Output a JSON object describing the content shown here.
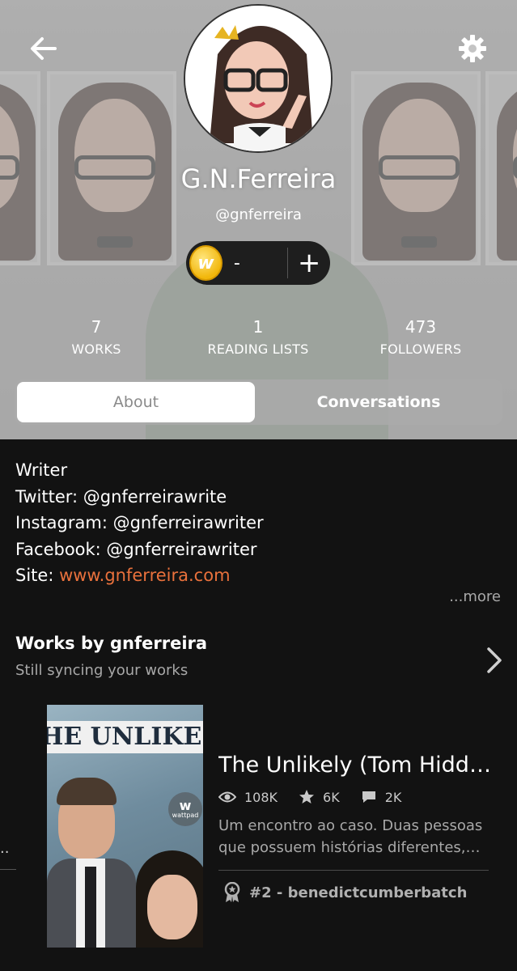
{
  "header": {
    "username": "G.N.Ferreira",
    "handle": "@gnferreira",
    "coins": {
      "count": "-",
      "plus": "+",
      "coin_glyph": "w"
    },
    "stats": [
      {
        "value": "7",
        "label": "WORKS"
      },
      {
        "value": "1",
        "label": "READING LISTS"
      },
      {
        "value": "473",
        "label": "FOLLOWERS"
      }
    ],
    "tabs": {
      "about": "About",
      "conversations": "Conversations"
    },
    "icons": {
      "back": "back-arrow-icon",
      "settings": "gear-icon"
    }
  },
  "bio": {
    "line1": "Writer",
    "line2": "Twitter: @gnferreirawrite",
    "line3": "Instagram: @gnferreirawriter",
    "line4": "Facebook: @gnferreirawriter",
    "site_prefix": "Site: ",
    "site_link": "www.gnferreira.com",
    "more": "...more"
  },
  "works": {
    "title": "Works by gnferreira",
    "subtitle": "Still syncing your works",
    "left_peek": "..",
    "story": {
      "cover_text": "HE UNLIKE",
      "cover_badge": "w",
      "cover_badge_label": "wattpad",
      "title": "The Unlikely (Tom Hidd…",
      "reads": "108K",
      "votes": "6K",
      "comments": "2K",
      "description_line1": "Um encontro ao caso. Duas pessoas",
      "description_line2": "que possuem histórias diferentes,…",
      "rank": "#2 - benedictcumberbatch"
    }
  },
  "colors": {
    "link": "#e9713c",
    "background": "#121212",
    "coin": "#f2b70c"
  }
}
